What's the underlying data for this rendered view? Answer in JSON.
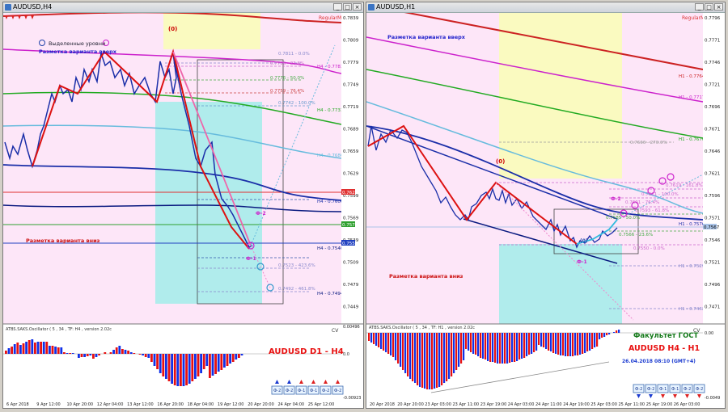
{
  "left": {
    "title": "AUDUSD,H4",
    "mode": "RegularMode",
    "zero_label": "(0)",
    "legend_label": "Выделенные уровни",
    "up_markup": "Разметка варианта вверх",
    "down_markup": "Разметка варианта вниз",
    "fib_levels": [
      "0.7811 - 0.0%",
      "0.7796 - 23.6%",
      "0.7776 - 50.0%",
      "0.7759 - 76.4%",
      "0.7742 - 100.0%",
      "0.7523 - 423.6%",
      "0.7492 - 461.8%"
    ],
    "line_labels": [
      "H4 - 0.7783",
      "H4 - 0.7731",
      "H4 - 0.7686",
      "H4 - 0.7606",
      "H4 - 0.7540",
      "H4 - 0.7494"
    ],
    "wave_labels": [
      "Ф-2",
      "Ф-1"
    ],
    "price_scale": [
      "0.7839",
      "0.7809",
      "0.7779",
      "0.7749",
      "0.7719",
      "0.7689",
      "0.7659",
      "0.7629",
      "0.7599",
      "0.7569",
      "0.7539",
      "0.7509",
      "0.7479",
      "0.7449"
    ],
    "current_prices": [
      "0.7620",
      "0.7575",
      "0.7550"
    ],
    "osc_header": "ATBS.SAKS.Oscillator ( 5 , 34 , TF: H4 , version 2.02c",
    "osc_title": "AUDUSD D1 - H4",
    "osc_cv": "CV",
    "osc_scale": [
      "0.00496",
      "0.0",
      "-0.00923"
    ],
    "osc_buttons": [
      "Ф-2",
      "Ф-2",
      "Ф-1",
      "Ф-1",
      "Ф-2",
      "Ф-2"
    ],
    "time_labels": [
      "6 Apr 2018",
      "9 Apr 12:00",
      "10 Apr 20:00",
      "12 Apr 04:00",
      "13 Apr 12:00",
      "16 Apr 20:00",
      "18 Apr 04:00",
      "19 Apr 12:00",
      "20 Apr 20:00",
      "24 Apr 04:00",
      "25 Apr 12:00"
    ]
  },
  "right": {
    "title": "AUDUSD,H1",
    "mode": "RegularMode",
    "zero_label": "(0)",
    "zero_label_2": "(0)",
    "up_markup": "Разметка варианта вверх",
    "down_markup": "Разметка варианта вниз",
    "fib_levels": [
      "0.7666 - 270.0%",
      "0.7619 - 161.8%",
      "0.7611 - 100.0%",
      "0.7601 - 76.4%",
      "0.7593 - 61.8%",
      "0.7585 - 50.0%",
      "0.7566 - 23.6%",
      "0.7550 - 0.0%"
    ],
    "line_labels": [
      "H1 - 0.7764",
      "H1 - 0.7717",
      "H1 - 0.7670",
      "H1 - 0.7576",
      "H1 - 0.7529",
      "H1 - 0.7462"
    ],
    "wave_labels": [
      "Ф-2",
      "Ф-1"
    ],
    "price_scale": [
      "0.7796",
      "0.7771",
      "0.7746",
      "0.7721",
      "0.7696",
      "0.7671",
      "0.7646",
      "0.7621",
      "0.7596",
      "0.7571",
      "0.7546",
      "0.7521",
      "0.7496",
      "0.7471"
    ],
    "current_prices": [
      "0.7567"
    ],
    "osc_header": "ATBS.SAKS.Oscillator ( 5 , 34 , TF: H1 , version 2.02c",
    "osc_title1": "Факультет ГОСТ",
    "osc_title2": "AUDUSD H4 - H1",
    "osc_date": "26.04.2018 08:10 (GMT+4)",
    "osc_cv": "CV",
    "osc_scale": [
      "0.00",
      "-0.0049"
    ],
    "osc_buttons": [
      "Ф-2",
      "Ф-2",
      "Ф-1",
      "Ф-1",
      "Ф-2",
      "Ф-2"
    ],
    "time_labels": [
      "20 Apr 2018",
      "20 Apr 20:00",
      "23 Apr 03:00",
      "23 Apr 11:00",
      "23 Apr 19:00",
      "24 Apr 03:00",
      "24 Apr 11:00",
      "24 Apr 19:00",
      "25 Apr 03:00",
      "25 Apr 11:00",
      "25 Apr 19:00",
      "26 Apr 03:00"
    ]
  },
  "colors": {
    "pink_bg": "#fde6f8",
    "yellow_zone": "#fafac0",
    "cyan_zone": "#b0ecec",
    "price_line": "#1a2ea8",
    "wave_red": "#dd1111",
    "osc_red": "#e81010",
    "osc_blue": "#1030e8"
  }
}
